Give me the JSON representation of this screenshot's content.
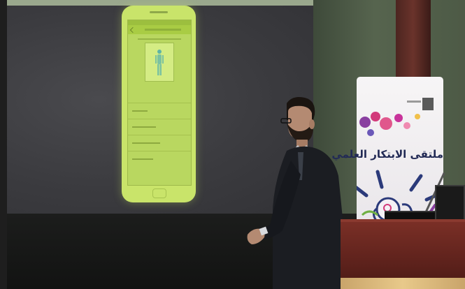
{
  "scene": {
    "description_free": true
  },
  "phone_app": {
    "list_items": [
      "",
      "",
      "",
      ""
    ]
  },
  "banner": {
    "arabic_text": "ملتقى الابتكار العلمي"
  },
  "colors": {
    "projection_accent": "#c9e46a",
    "banner_text": "#222a55",
    "podium": "#6a2a22"
  }
}
